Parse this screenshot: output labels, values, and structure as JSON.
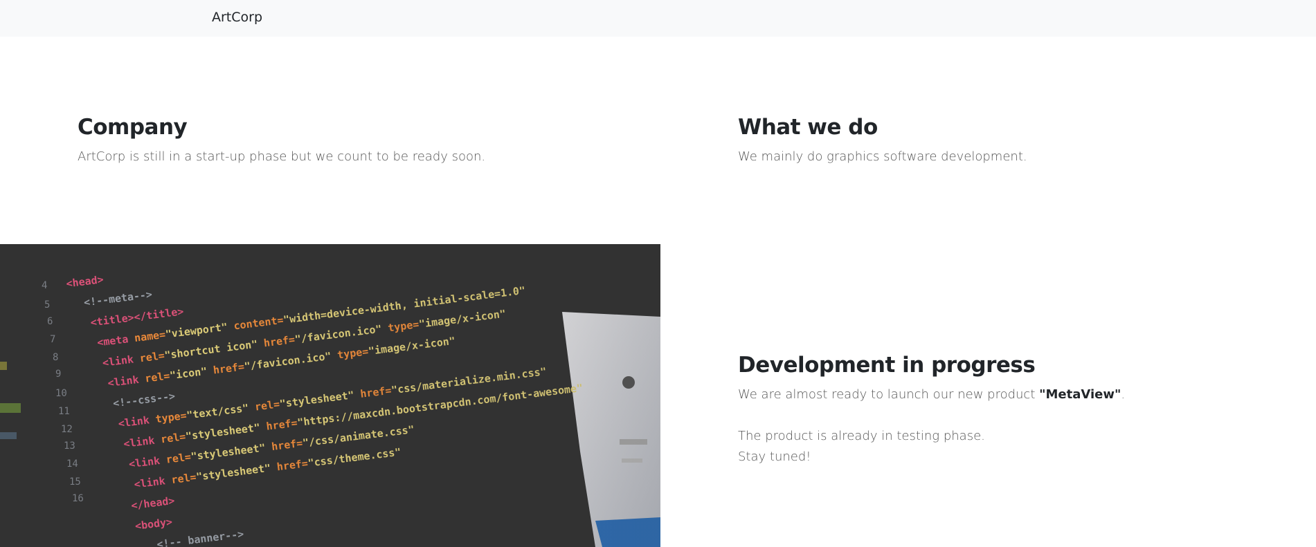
{
  "nav": {
    "brand": "ArtCorp"
  },
  "company": {
    "title": "Company",
    "text": "ArtCorp is still in a start-up phase but we count to be ready soon."
  },
  "what_we_do": {
    "title": "What we do",
    "text": "We mainly do graphics software development."
  },
  "development": {
    "title": "Development in progress",
    "line1_prefix": "We are almost ready to launch our new product ",
    "product": "\"MetaView\"",
    "line1_suffix": ".",
    "line2": "The product is already in testing phase.",
    "line3": "Stay tuned!"
  },
  "photo": {
    "code_lines": [
      "<!--meta-->",
      "<title></title>",
      "<meta name=\"viewport\" content=\"width=device-width, initial-scale=1.0\">",
      "<link rel=\"shortcut icon\" href=\"/favicon.ico\" type=\"image/x-icon\">",
      "<link rel=\"icon\" href=\"/favicon.ico\" type=\"image/x-icon\">",
      "<!--css-->",
      "<link type=\"text/css\" rel=\"stylesheet\" href=\"css/materialize.min.css\">",
      "<link rel=\"stylesheet\" href=\"https://maxcdn.bootstrapcdn.com/font-awesome\">",
      "<link rel=\"stylesheet\" href=\"/css/animate.css\">",
      "<link rel=\"stylesheet\" href=\"css/theme.css\">",
      "</head>",
      "<body>",
      "<!-- banner-->"
    ]
  }
}
